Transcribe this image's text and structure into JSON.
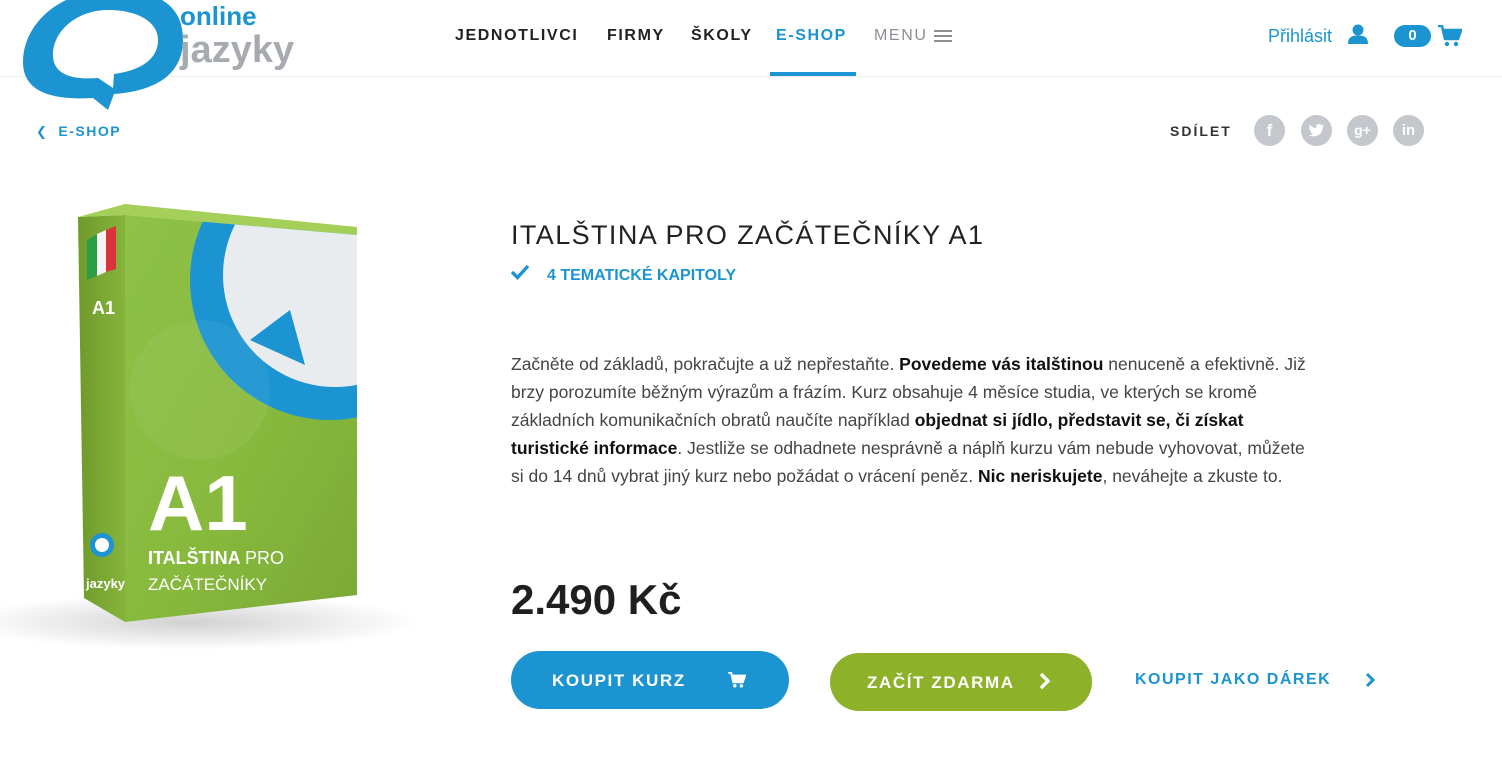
{
  "brand": {
    "line1": "online",
    "line2": "jazyky"
  },
  "nav": {
    "items": [
      {
        "label": "JEDNOTLIVCI"
      },
      {
        "label": "FIRMY"
      },
      {
        "label": "ŠKOLY"
      },
      {
        "label": "E-SHOP"
      },
      {
        "label": "MENU"
      }
    ],
    "active": "E-SHOP"
  },
  "header": {
    "login_label": "Přihlásit",
    "cart_count": "0"
  },
  "breadcrumb": {
    "back_label": "E-SHOP"
  },
  "share": {
    "label": "SDÍLET",
    "networks": [
      "facebook-icon",
      "twitter-icon",
      "google-plus-icon",
      "linkedin-icon"
    ]
  },
  "product": {
    "box": {
      "level_small": "A1",
      "level_big": "A1",
      "name_line1_bold": "ITALŠTINA",
      "name_line1_rest": "PRO",
      "name_line2": "ZAČÁTEČNÍKY",
      "logo_text": "jazyky"
    },
    "title": "ITALŠTINA PRO ZAČÁTEČNÍKY A1",
    "feature": "4 TEMATICKÉ KAPITOLY",
    "description": {
      "p1": "Začněte od základů, pokračujte a už nepřestaňte. ",
      "b1": "Povedeme vás italštinou",
      "p2": " nenuceně a efektivně. Již brzy porozumíte běžným výrazům a frázím. Kurz obsahuje 4 měsíce studia, ve kterých se kromě základních komunikačních obratů naučíte například ",
      "b2": "objednat si jídlo, představit se, či získat turistické informace",
      "p3": ". Jestliže se odhadnete nesprávně a náplň kurzu vám nebude vyhovovat, můžete si do 14 dnů vybrat jiný kurz nebo požádat o vrácení peněz. ",
      "b3": "Nic neriskujete",
      "p4": ", neváhejte a zkuste to."
    },
    "price": "2.490 Kč",
    "buy_label": "KOUPIT KURZ",
    "free_label": "ZAČÍT ZDARMA",
    "gift_label": "KOUPIT JAKO DÁREK"
  },
  "colors": {
    "accent": "#1b94d1",
    "green": "#8db229",
    "grey": "#c4c7cb"
  }
}
